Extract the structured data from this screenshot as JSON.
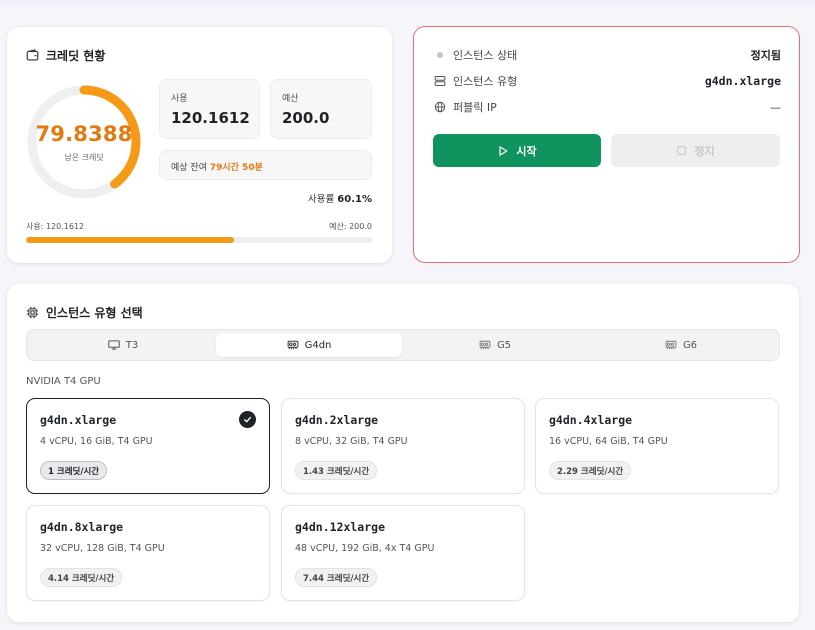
{
  "credit": {
    "title": "크레딧 현황",
    "remaining": "79.8388",
    "remaining_label": "남은 크레딧",
    "remaining_fraction": 0.399,
    "used_label": "사용",
    "used_value": "120.1612",
    "budget_label": "예산",
    "budget_value": "200.0",
    "remain_prefix": "예상 잔여 ",
    "remain_time": "79시간 50분",
    "usage_rate_label": "사용률 ",
    "usage_rate_value": "60.1%",
    "usage_fraction": 0.601,
    "bar_left_label": "사용: 120.1612",
    "bar_right_label": "예산: 200.0",
    "accent_color": "#f59a16"
  },
  "instance": {
    "status_label": "인스턴스 상태",
    "status_value": "정지됨",
    "type_label": "인스턴스 유형",
    "type_value": "g4dn.xlarge",
    "ip_label": "퍼블릭 IP",
    "ip_value": "—",
    "start_label": "시작",
    "stop_label": "정지",
    "start_color": "#10935f",
    "border_color": "#ef6b74"
  },
  "type_select": {
    "title": "인스턴스 유형 선택",
    "tabs": [
      {
        "label": "T3",
        "icon": "monitor-icon"
      },
      {
        "label": "G4dn",
        "icon": "gpu-icon",
        "active": true
      },
      {
        "label": "G5",
        "icon": "gpu-icon"
      },
      {
        "label": "G6",
        "icon": "gpu-icon"
      }
    ],
    "gpu_label": "NVIDIA T4 GPU",
    "instances": [
      {
        "name": "g4dn.xlarge",
        "spec": "4 vCPU, 16 GiB, T4 GPU",
        "price": "1 크레딧/시간",
        "selected": true
      },
      {
        "name": "g4dn.2xlarge",
        "spec": "8 vCPU, 32 GiB, T4 GPU",
        "price": "1.43 크레딧/시간"
      },
      {
        "name": "g4dn.4xlarge",
        "spec": "16 vCPU, 64 GiB, T4 GPU",
        "price": "2.29 크레딧/시간"
      },
      {
        "name": "g4dn.8xlarge",
        "spec": "32 vCPU, 128 GiB, T4 GPU",
        "price": "4.14 크레딧/시간"
      },
      {
        "name": "g4dn.12xlarge",
        "spec": "48 vCPU, 192 GiB, 4x T4 GPU",
        "price": "7.44 크레딧/시간"
      }
    ]
  }
}
